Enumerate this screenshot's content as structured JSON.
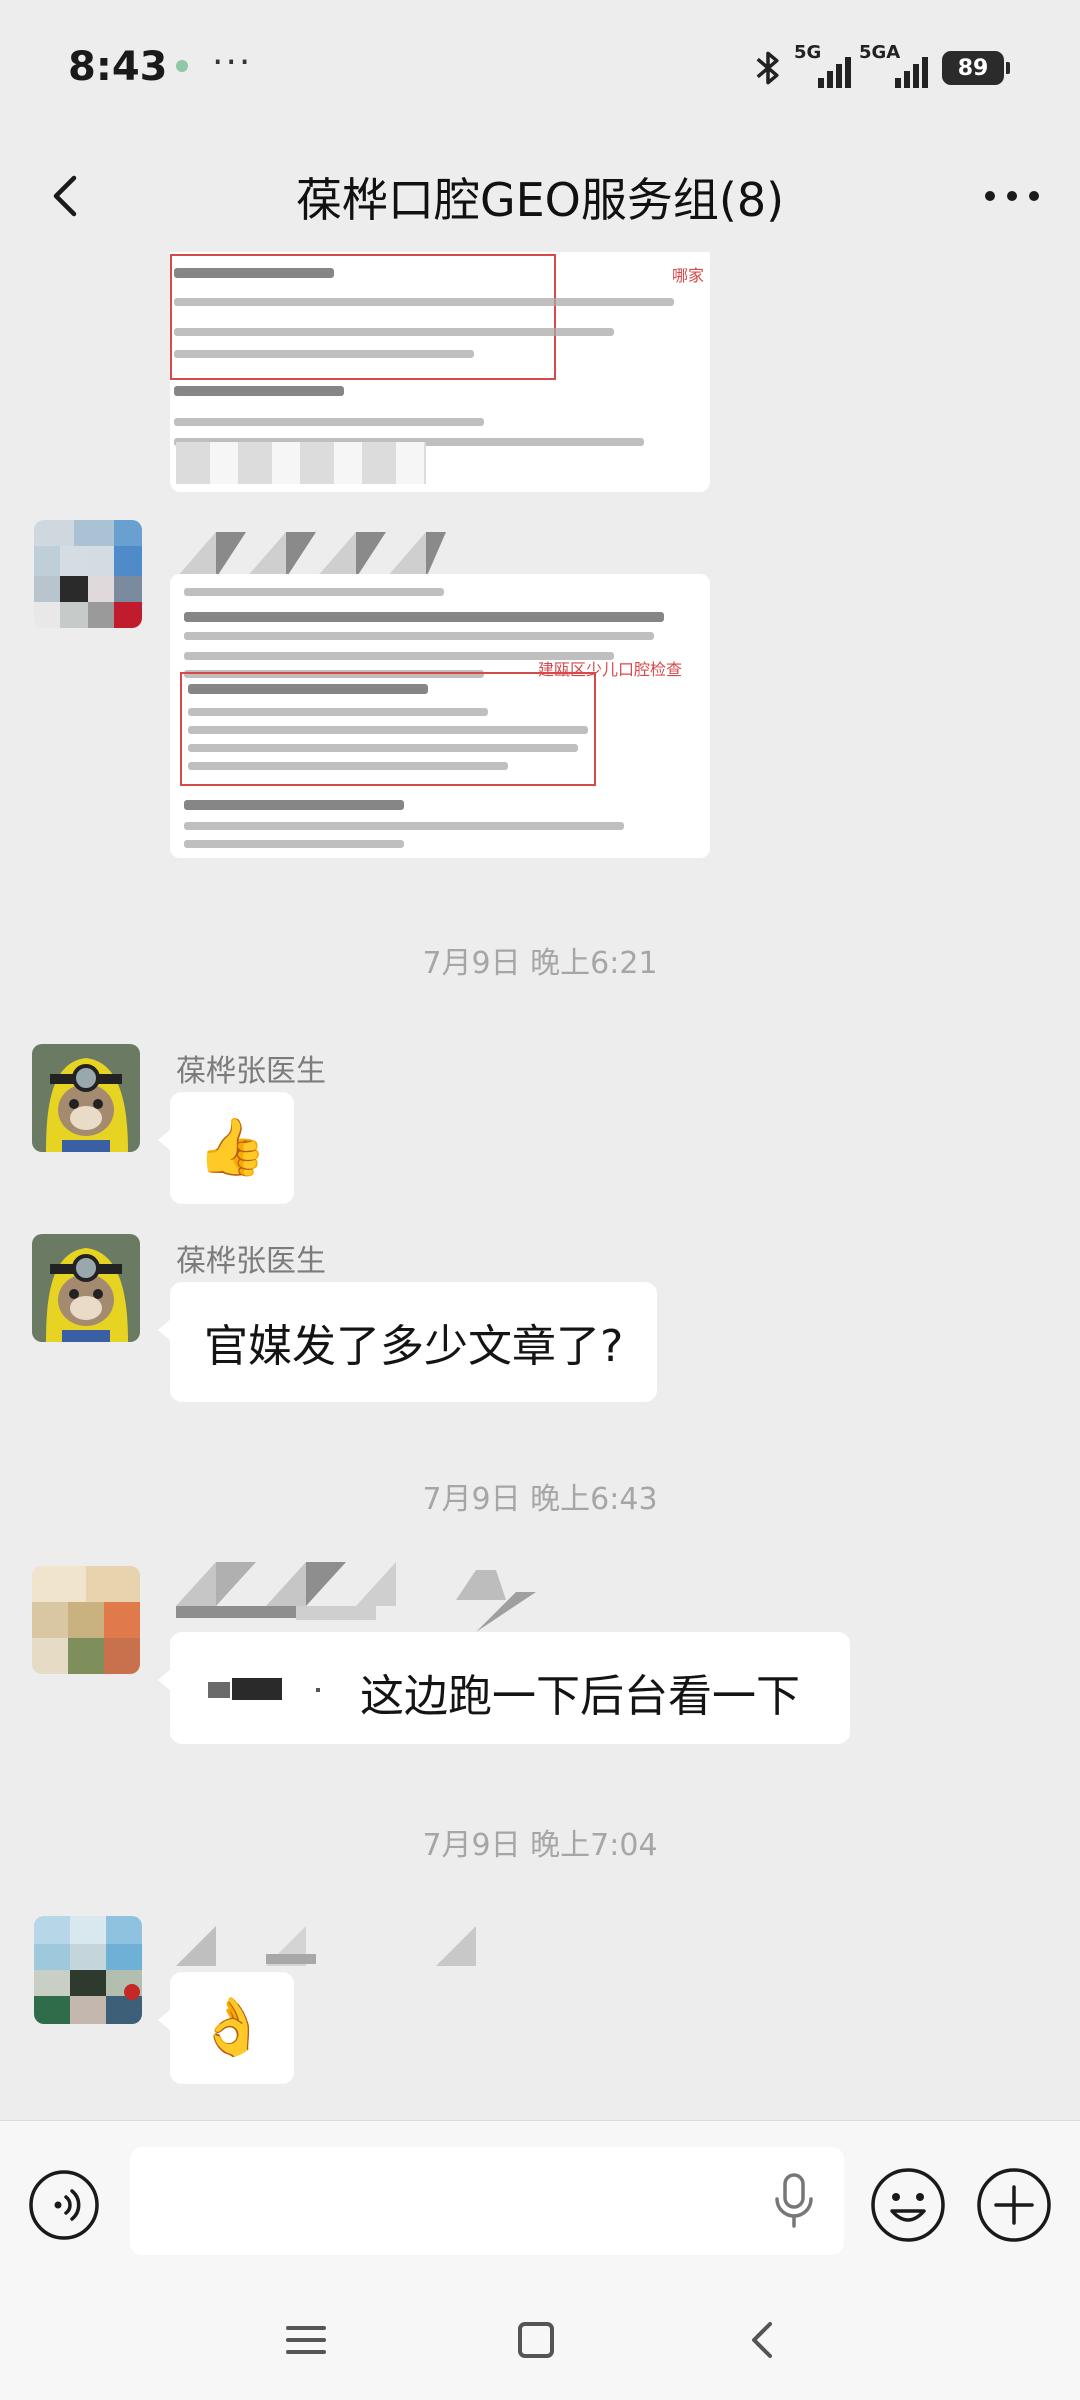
{
  "status_bar": {
    "time": "8:43",
    "more": "···",
    "network1": "5G",
    "network2": "5GA",
    "battery": "89"
  },
  "header": {
    "title": "葆桦口腔GEO服务组(8)"
  },
  "messages": {
    "image1_label": "哪家",
    "image2_label": "建瓯区少儿口腔检查",
    "time1": "7月9日 晚上6:21",
    "sender1": "葆桦张医生",
    "emoji1": "👍",
    "sender2": "葆桦张医生",
    "text2": "官媒发了多少文章了?",
    "time2": "7月9日 晚上6:43",
    "text3": "这边跑一下后台看一下",
    "time3": "7月9日 晚上7:04",
    "emoji4": "👌"
  },
  "input": {
    "placeholder": ""
  },
  "icons": {
    "back": "chevron-left-icon",
    "more": "more-horizontal-icon",
    "voice": "voice-icon",
    "mic": "mic-icon",
    "emoji": "smiley-icon",
    "plus": "plus-icon"
  }
}
